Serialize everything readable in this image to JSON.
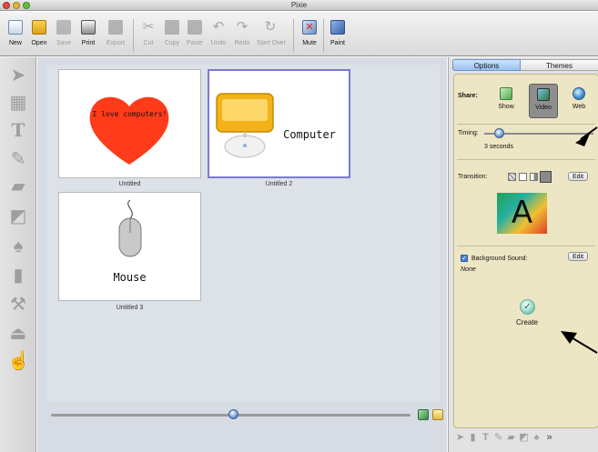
{
  "window": {
    "title": "Pixie"
  },
  "toolbar": {
    "items": [
      {
        "label": "New",
        "icon": "new-document-icon",
        "enabled": true
      },
      {
        "label": "Open",
        "icon": "open-folder-icon",
        "enabled": true
      },
      {
        "label": "Save",
        "icon": "save-disk-icon",
        "enabled": false
      },
      {
        "label": "Print",
        "icon": "printer-icon",
        "enabled": true
      },
      {
        "label": "Export",
        "icon": "export-icon",
        "enabled": false
      },
      {
        "label": "Cut",
        "icon": "scissors-icon",
        "enabled": false
      },
      {
        "label": "Copy",
        "icon": "copy-icon",
        "enabled": false
      },
      {
        "label": "Paste",
        "icon": "paste-icon",
        "enabled": false
      },
      {
        "label": "Undo",
        "icon": "undo-icon",
        "enabled": false
      },
      {
        "label": "Redo",
        "icon": "redo-icon",
        "enabled": false
      },
      {
        "label": "Start Over",
        "icon": "start-over-icon",
        "enabled": false
      },
      {
        "label": "Mute",
        "icon": "mute-icon",
        "enabled": true
      },
      {
        "label": "Paint",
        "icon": "paint-icon",
        "enabled": true
      }
    ]
  },
  "palette": {
    "tools": [
      "arrow-tool-icon",
      "selection-tool-icon",
      "text-tool-icon",
      "pencil-tool-icon",
      "eraser-tool-icon",
      "fill-tool-icon",
      "paint-bucket-icon",
      "spray-tool-icon",
      "brush-tool-icon",
      "stamp-tool-icon",
      "hand-tool-icon"
    ]
  },
  "slides": [
    {
      "caption": "Untitled",
      "text": "I love computers!"
    },
    {
      "caption": "Untitled 2",
      "text": "Computer"
    },
    {
      "caption": "Untitled 3",
      "text": "Mouse"
    }
  ],
  "panel": {
    "tabs": [
      "Options",
      "Themes"
    ],
    "share": {
      "label": "Share:",
      "options": [
        {
          "label": "Show",
          "icon": "show-icon"
        },
        {
          "label": "Video",
          "icon": "video-icon",
          "selected": true
        },
        {
          "label": "Web",
          "icon": "web-icon"
        }
      ]
    },
    "timing": {
      "label": "Timing:",
      "value": "3 seconds",
      "level": 0.12
    },
    "transition": {
      "label": "Transition:",
      "edit": "Edit",
      "preview_letter": "A"
    },
    "background_sound": {
      "label": "Background Sound:",
      "checked": true,
      "value": "None",
      "edit": "Edit"
    },
    "create": {
      "label": "Create"
    }
  },
  "colors": {
    "heart": "#ff3b1a",
    "panel_bg": "#ede6c4",
    "canvas_bg": "#d6dbe4",
    "tab_active": "#9ac1f0"
  }
}
